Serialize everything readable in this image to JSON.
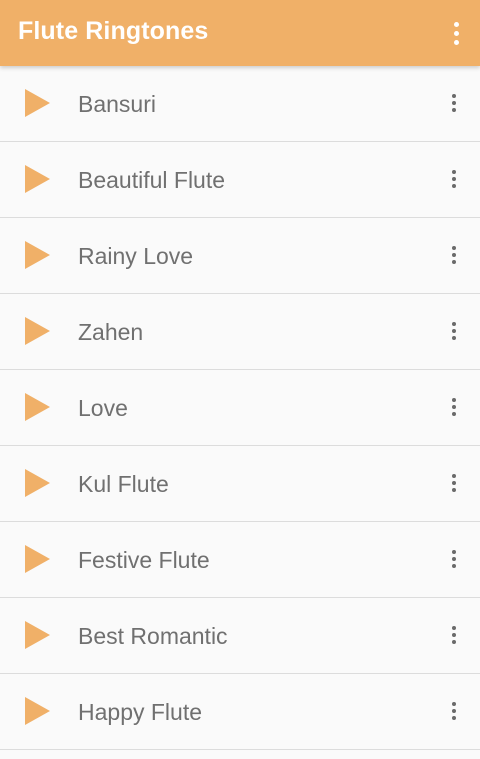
{
  "app": {
    "title": "Flute Ringtones",
    "accent_color": "#f0b068",
    "overflow_icon": "more-vert-icon"
  },
  "ringtones": [
    {
      "name": "Bansuri"
    },
    {
      "name": "Beautiful Flute"
    },
    {
      "name": "Rainy Love"
    },
    {
      "name": "Zahen"
    },
    {
      "name": "Love"
    },
    {
      "name": "Kul Flute"
    },
    {
      "name": "Festive Flute"
    },
    {
      "name": "Best Romantic"
    },
    {
      "name": "Happy Flute"
    }
  ],
  "row_icons": {
    "play": "play-icon",
    "menu": "more-vert-icon"
  }
}
